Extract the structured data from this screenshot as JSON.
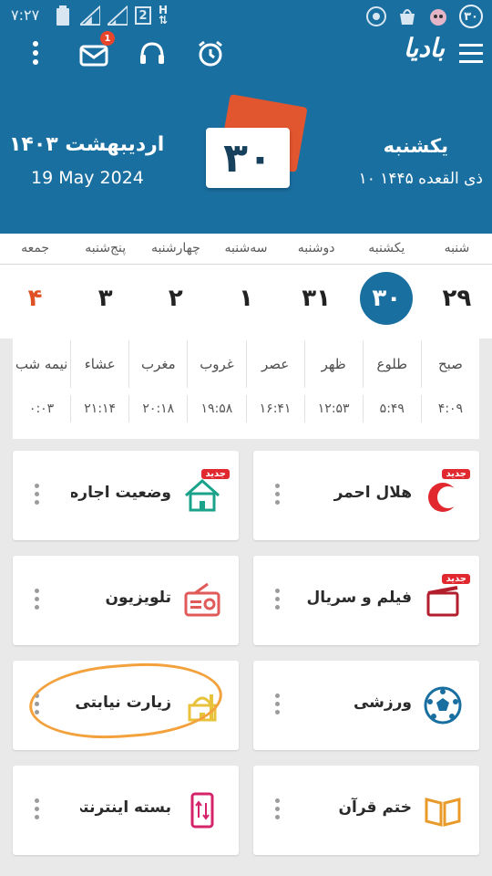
{
  "status_bar": {
    "time": "۷:۲۷",
    "sim_label": "2",
    "network_type": "H",
    "date_badge": "۳۰"
  },
  "app_bar": {
    "logo": "بادیا",
    "message_badge": "1",
    "icons": [
      "menu-icon",
      "alarm-icon",
      "headset-icon",
      "mail-icon",
      "more-icon"
    ]
  },
  "header": {
    "persian_month_year": "اردیبهشت ۱۴۰۳",
    "gregorian_date": "19 May 2024",
    "day_number": "۳۰",
    "weekday": "یکشنبه",
    "hijri_date": "۱۰ ذی القعده ۱۴۴۵"
  },
  "week": {
    "names": [
      "شنبه",
      "یکشنبه",
      "دوشنبه",
      "سه‌شنبه",
      "چهارشنبه",
      "پنج‌شنبه",
      "جمعه"
    ],
    "days": [
      "۲۹",
      "۳۰",
      "۳۱",
      "۱",
      "۲",
      "۳",
      "۴"
    ],
    "selected_index": 1,
    "friday_color": "#e05025"
  },
  "prayer_times": {
    "names": [
      "صبح",
      "طلوع",
      "ظهر",
      "عصر",
      "غروب",
      "مغرب",
      "عشاء",
      "نیمه شب"
    ],
    "times": [
      "۴:۰۹",
      "۵:۴۹",
      "۱۲:۵۳",
      "۱۶:۴۱",
      "۱۹:۵۸",
      "۲۰:۱۸",
      "۲۱:۱۴",
      "۰:۰۳"
    ]
  },
  "cards": {
    "helal_ahmar": {
      "label": "هلال احمر",
      "tag": "جدید"
    },
    "vaziat_ejare": {
      "label": "وضعیت اجاره",
      "tag": "جدید"
    },
    "film_serial": {
      "label": "فیلم و سریال",
      "tag": "جدید"
    },
    "television": {
      "label": "تلویزیون"
    },
    "varzeshi": {
      "label": "ورزشی"
    },
    "ziarat": {
      "label": "زیارت نیابتی"
    },
    "khatm_quran": {
      "label": "ختم قرآن"
    },
    "baste": {
      "label": "بسته اینترنتی"
    }
  },
  "colors": {
    "primary": "#1a6fa1",
    "accent_red": "#e0282e",
    "highlight": "#f3a13c"
  }
}
